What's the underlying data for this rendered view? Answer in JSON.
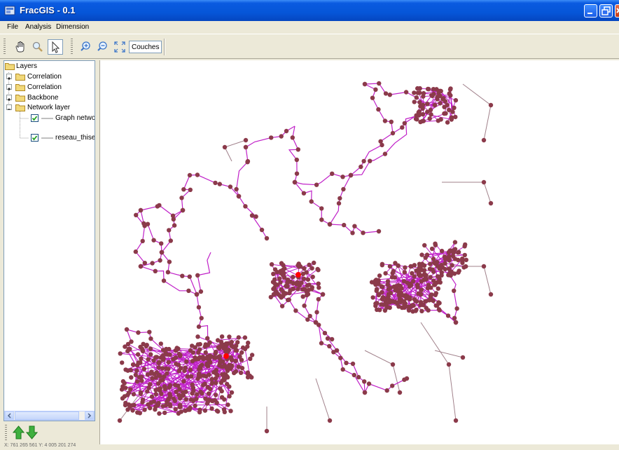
{
  "window": {
    "title": "FracGIS - 0.1"
  },
  "menu": [
    "File",
    "Analysis",
    "Dimension"
  ],
  "toolbar": {
    "tools": [
      "hand-pan-icon",
      "magnifier-icon",
      "arrow-select-icon",
      "zoom-in-icon",
      "zoom-out-icon",
      "zoom-extent-icon"
    ],
    "couches_label": "Couches"
  },
  "layers": {
    "root_label": "Layers",
    "groups": [
      "Correlation",
      "Correlation",
      "Backbone",
      "Network layer"
    ],
    "network_children": [
      {
        "label": "Graph networ",
        "checked": true
      },
      {
        "label": "reseau_thise",
        "checked": true
      }
    ]
  },
  "statusbar": {
    "text": "X: 761 265 561  Y: 4 005 201 274"
  },
  "colors": {
    "titlebar": "#0656d8",
    "edge_main": "#c020c8",
    "edge_minor": "#a0808a",
    "node": "#8b3a4a",
    "highlight": "#ff0000",
    "arrow_up": "#2a9a2a"
  }
}
